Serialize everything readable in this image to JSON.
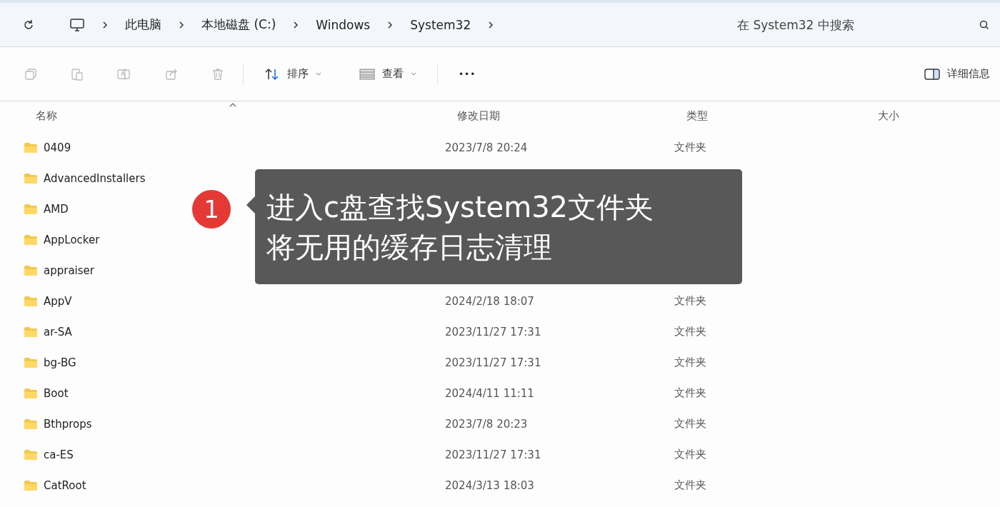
{
  "breadcrumb": [
    "此电脑",
    "本地磁盘 (C:)",
    "Windows",
    "System32"
  ],
  "search": {
    "placeholder": "在 System32 中搜索"
  },
  "toolbar": {
    "sort": "排序",
    "view": "查看",
    "more": "•••",
    "details": "详细信息"
  },
  "columns": [
    "名称",
    "修改日期",
    "类型",
    "大小"
  ],
  "rows": [
    {
      "name": "0409",
      "modified": "2023/7/8 20:24",
      "type": "文件夹"
    },
    {
      "name": "AdvancedInstallers"
    },
    {
      "name": "AMD"
    },
    {
      "name": "AppLocker"
    },
    {
      "name": "appraiser"
    },
    {
      "name": "AppV",
      "modified": "2024/2/18 18:07",
      "type": "文件夹"
    },
    {
      "name": "ar-SA",
      "modified": "2023/11/27 17:31",
      "type": "文件夹"
    },
    {
      "name": "bg-BG",
      "modified": "2023/11/27 17:31",
      "type": "文件夹"
    },
    {
      "name": "Boot",
      "modified": "2024/4/11 11:11",
      "type": "文件夹"
    },
    {
      "name": "Bthprops",
      "modified": "2023/7/8 20:23",
      "type": "文件夹"
    },
    {
      "name": "ca-ES",
      "modified": "2023/11/27 17:31",
      "type": "文件夹"
    },
    {
      "name": "CatRoot",
      "modified": "2024/3/13 18:03",
      "type": "文件夹"
    }
  ],
  "callout": {
    "step": "1",
    "lines": [
      "进入c盘查找System32文件夹",
      "将无用的缓存日志清理"
    ]
  }
}
